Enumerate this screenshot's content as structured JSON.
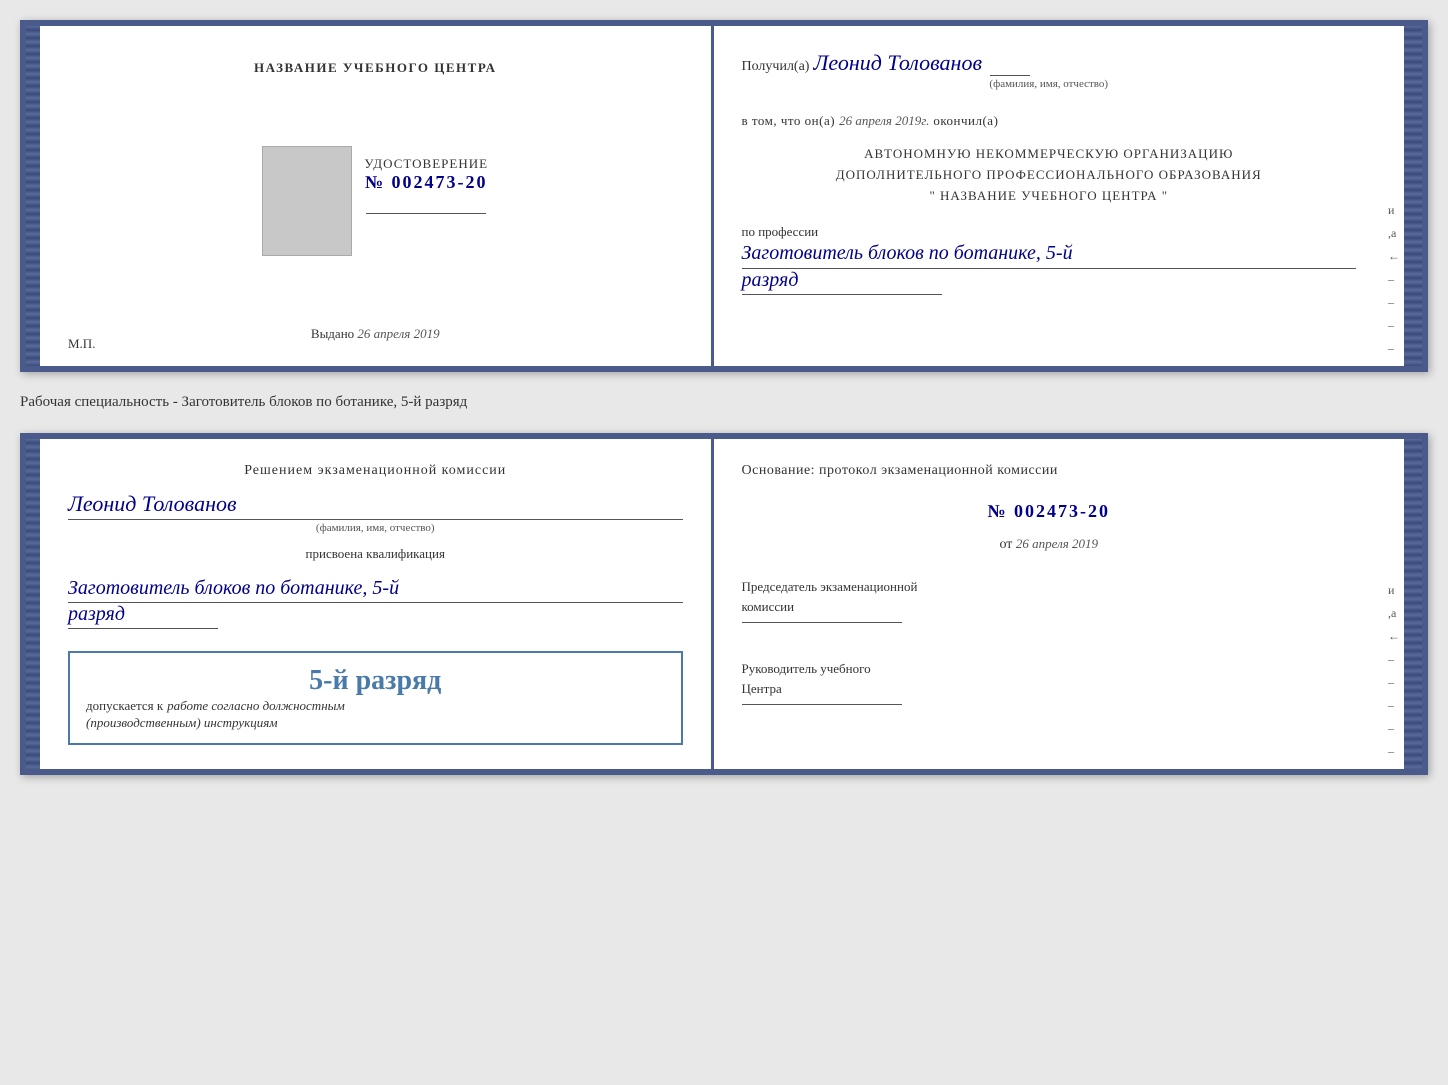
{
  "document1": {
    "left": {
      "training_center_label": "НАЗВАНИЕ УЧЕБНОГО ЦЕНТРА",
      "certificate_title": "УДОСТОВЕРЕНИЕ",
      "certificate_number_prefix": "№",
      "certificate_number": "002473-20",
      "issued_label": "Выдано",
      "issued_date": "26 апреля 2019",
      "mp_label": "М.П."
    },
    "right": {
      "recipient_prefix": "Получил(а)",
      "recipient_name": "Леонид Толованов",
      "fio_label": "(фамилия, имя, отчество)",
      "completed_prefix": "в том, что он(а)",
      "completed_date": "26 апреля 2019г.",
      "completed_suffix": "окончил(а)",
      "org_line1": "АВТОНОМНУЮ НЕКОММЕРЧЕСКУЮ ОРГАНИЗАЦИЮ",
      "org_line2": "ДОПОЛНИТЕЛЬНОГО ПРОФЕССИОНАЛЬНОГО ОБРАЗОВАНИЯ",
      "org_quote_open": "\"",
      "org_name": "НАЗВАНИЕ УЧЕБНОГО ЦЕНТРА",
      "org_quote_close": "\"",
      "profession_label": "по профессии",
      "profession_value": "Заготовитель блоков по ботанике, 5-й",
      "razryad_value": "разряд"
    }
  },
  "specialty_label": "Рабочая специальность - Заготовитель блоков по ботанике, 5-й разряд",
  "document2": {
    "left": {
      "decision_title": "Решением экзаменационной комиссии",
      "name": "Леонид Толованов",
      "fio_label": "(фамилия, имя, отчество)",
      "assigned_label": "присвоена квалификация",
      "profession": "Заготовитель блоков по ботанике, 5-й",
      "razryad": "разряд",
      "stamp_rank": "5-й разряд",
      "stamp_admission": "допускается к",
      "stamp_work": "работе согласно должностным",
      "stamp_instructions": "(производственным) инструкциям"
    },
    "right": {
      "basis_title": "Основание: протокол экзаменационной комиссии",
      "basis_number_prefix": "№",
      "basis_number": "002473-20",
      "basis_date_prefix": "от",
      "basis_date": "26 апреля 2019",
      "chair_label_line1": "Председатель экзаменационной",
      "chair_label_line2": "комиссии",
      "director_label_line1": "Руководитель учебного",
      "director_label_line2": "Центра"
    }
  },
  "right_edge_chars": [
    "и",
    "а",
    "←",
    "–",
    "–",
    "–",
    "–",
    "–"
  ]
}
